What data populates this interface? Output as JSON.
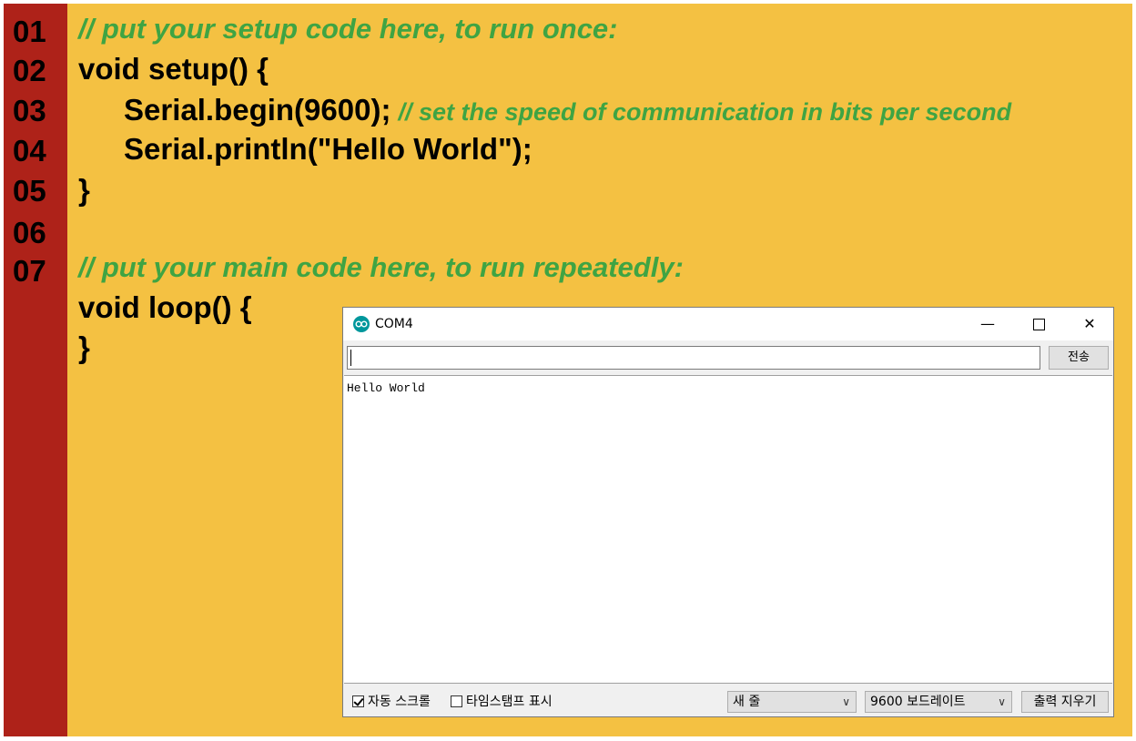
{
  "code": {
    "line_numbers": [
      "01",
      "02",
      "03",
      "04",
      "05",
      "06",
      "07"
    ],
    "comment_setup": "// put your setup code here, to run once:",
    "setup_signature": "void setup() {",
    "serial_begin": "Serial.begin(9600);",
    "serial_begin_comment": "// set the speed of communication in bits per second",
    "serial_println": "Serial.println(\"Hello World\");",
    "setup_close": "}",
    "comment_loop": "// put your main code here, to run repeatedly:",
    "loop_signature": "void loop() {",
    "loop_close": "}"
  },
  "serial_monitor": {
    "title": "COM4",
    "window_controls": {
      "minimize": "—",
      "close": "✕"
    },
    "send_input_value": "",
    "send_button": "전송",
    "output_lines": [
      "Hello World"
    ],
    "autoscroll": {
      "label": "자동 스크롤",
      "checked": true
    },
    "timestamp": {
      "label": "타임스탬프 표시",
      "checked": false
    },
    "line_ending": "새 줄",
    "baud_rate": "9600 보드레이트",
    "clear_output_button": "출력 지우기",
    "chevron": "∨"
  },
  "colors": {
    "background": "#f4c142",
    "gutter": "#ae2219",
    "comment": "#3fa443",
    "app_icon": "#00979c"
  }
}
